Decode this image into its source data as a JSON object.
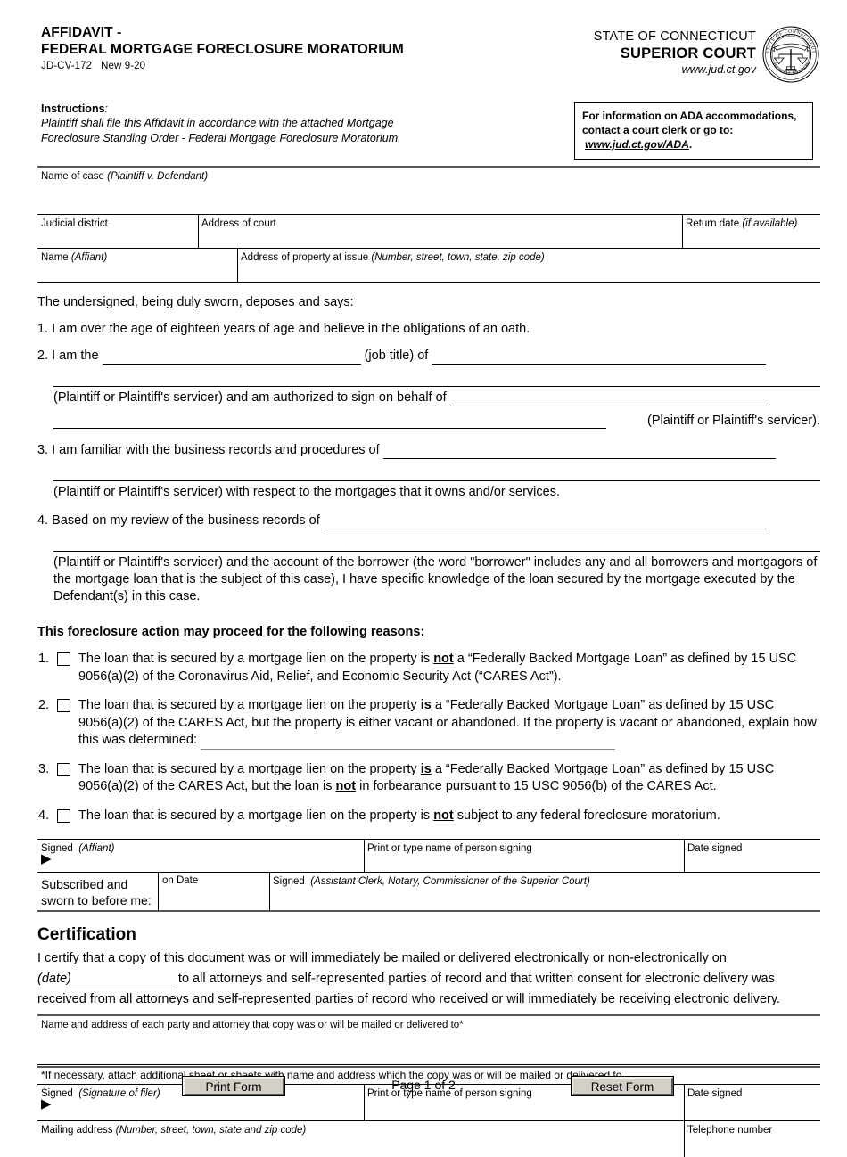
{
  "header": {
    "title_line1": "AFFIDAVIT -",
    "title_line2": "FEDERAL MORTGAGE FORECLOSURE MORATORIUM",
    "form_number": "JD-CV-172",
    "revision": "New 9-20",
    "state": "STATE OF CONNECTICUT",
    "court": "SUPERIOR COURT",
    "website": "www.jud.ct.gov",
    "seal_outer_top_text": "STATE OF CONNECTICUT",
    "seal_outer_bottom_text": "JUDICIAL BRANCH"
  },
  "instructions": {
    "heading": "Instructions",
    "heading_colon": ":",
    "line1": "Plaintiff shall file this Affidavit in accordance with the attached Mortgage",
    "line2": "Foreclosure Standing Order - Federal Mortgage Foreclosure Moratorium."
  },
  "ada_box": {
    "line1": "For information on ADA accommodations,",
    "line2": "contact a court clerk or go to:",
    "link": "www.jud.ct.gov/ADA",
    "period": "."
  },
  "case_fields": {
    "name_of_case_label": "Name of case",
    "name_of_case_hint": "(Plaintiff v. Defendant)",
    "judicial_district_label": "Judicial district",
    "address_of_court_label": "Address of court",
    "return_date_label": "Return date",
    "return_date_hint": "(if available)",
    "name_affiant_label": "Name",
    "name_affiant_hint": "(Affiant)",
    "property_address_label": "Address of property at issue",
    "property_address_hint": "(Number, street, town, state, zip code)"
  },
  "body": {
    "lead": "The undersigned, being duly sworn, deposes and says:",
    "item1": {
      "num": "1.",
      "text": "I am over the age of eighteen years of age and believe in the obligations of an oath."
    },
    "item2": {
      "num": "2.",
      "text_a": "I am the",
      "text_b": "(job title) of",
      "text_c": "(Plaintiff or Plaintiff's servicer) and am authorized to sign on behalf of",
      "text_d": "(Plaintiff or Plaintiff's servicer)."
    },
    "item3": {
      "num": "3.",
      "text_a": "I am familiar with the business records and procedures of",
      "text_b": "(Plaintiff or Plaintiff's servicer) with respect to the mortgages that it owns and/or services."
    },
    "item4": {
      "num": "4.",
      "text_a": "Based on my review of the business records of",
      "text_b": "(Plaintiff or Plaintiff's servicer) and the account of the borrower (the word \"borrower\" includes any and all borrowers and mortgagors of the mortgage loan that is the subject of this case), I have specific knowledge of the loan secured by the mortgage executed by the Defendant(s) in this case."
    }
  },
  "reasons": {
    "heading": "This foreclosure action may proceed for the following reasons:",
    "items": [
      {
        "num": "1.",
        "part1": "The loan that is secured by a mortgage lien on the property is",
        "emph1": "not",
        "part2": "a “Federally Backed Mortgage Loan” as defined by 15 USC 9056(a)(2) of the Coronavirus Aid, Relief, and Economic Security Act (“CARES Act”)."
      },
      {
        "num": "2.",
        "part1": "The loan that is secured by a mortgage lien on the property",
        "emph1": "is",
        "part2": "a “Federally Backed Mortgage Loan” as defined by 15 USC 9056(a)(2) of the CARES Act, but the property is either vacant or abandoned. If the property is vacant or abandoned, explain how this was determined:"
      },
      {
        "num": "3.",
        "part1": "The loan that is secured by a mortgage lien on the property",
        "emph1": "is",
        "part2": "a “Federally Backed Mortgage Loan” as defined by 15 USC 9056(a)(2) of the CARES Act, but the loan is",
        "emph2": "not",
        "part3": "in forbearance pursuant to 15 USC 9056(b) of the CARES Act."
      },
      {
        "num": "4.",
        "part1": "The loan that is secured by a mortgage lien on the property is",
        "emph1": "not",
        "part2": "subject to any federal foreclosure moratorium."
      }
    ]
  },
  "affiant_signature": {
    "signed_label": "Signed",
    "signed_hint": "(Affiant)",
    "arrow": "▶",
    "print_name_label": "Print or type name of person signing",
    "date_signed_label": "Date signed",
    "subscribed_line1": "Subscribed and",
    "subscribed_line2": "sworn to before me:",
    "on_date_label": "on Date",
    "notary_signed_label": "Signed",
    "notary_signed_hint": "(Assistant Clerk, Notary, Commissioner of the Superior Court)"
  },
  "certification": {
    "heading": "Certification",
    "line1": "I certify that a copy of this document was or will immediately be mailed or delivered electronically or non-electronically on",
    "date_label": "(date)",
    "line2": "to all attorneys and self-represented parties of record and that written consent for electronic delivery was",
    "line3": "received from all attorneys and self-represented parties of record who received or will immediately be receiving electronic delivery.",
    "names_label": "Name and address of each party and attorney that copy was or will be mailed or delivered to*",
    "footnote": "*If necessary, attach additional sheet or sheets with name and address which the copy was or will be mailed or delivered to."
  },
  "filer_signature": {
    "signed_label": "Signed",
    "signed_hint": "(Signature of filer)",
    "arrow": "▶",
    "print_name_label": "Print or type name of person signing",
    "date_signed_label": "Date signed",
    "mailing_address_label": "Mailing address",
    "mailing_address_hint": "(Number, street, town, state and zip code)",
    "telephone_label": "Telephone number"
  },
  "footer": {
    "print_button": "Print Form",
    "page_indicator": "Page 1 of 2",
    "reset_button": "Reset Form"
  }
}
